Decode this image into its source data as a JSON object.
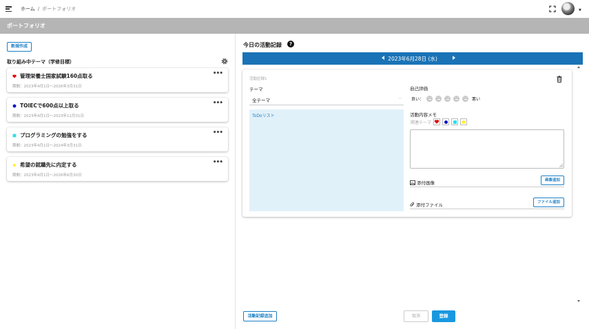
{
  "header": {
    "breadcrumb_home": "ホーム",
    "breadcrumb_sep": "/",
    "breadcrumb_current": "ポートフォリオ"
  },
  "page_title": "ポートフォリオ",
  "left": {
    "new_button": "新規作成",
    "section_title": "取り組み中テーマ（学修目標）",
    "themes": [
      {
        "title": "管理栄養士国家試験160点取る",
        "period": "期間：2023年4月1日〜2026年3月31日",
        "mark": "heart",
        "color": "#e00000"
      },
      {
        "title": "TOIECで600点以上取る",
        "period": "期間：2023年4月1日〜2023年12月31日",
        "mark": "circle",
        "color": "#0a12c8"
      },
      {
        "title": "プログラミングの勉強をする",
        "period": "期間：2023年4月1日〜2024年3月31日",
        "mark": "square",
        "color": "#2ee0e8"
      },
      {
        "title": "希望の就職先に内定する",
        "period": "期間：2023年4月1日〜2026年6月30日",
        "mark": "star",
        "color": "#ffee00"
      }
    ]
  },
  "right": {
    "title": "今日の活動記録",
    "help_icon": "?",
    "date": "2023年6月28日 (水)",
    "record": {
      "label": "活動記録1",
      "theme_label": "テーマ",
      "theme_value": "全テーマ",
      "todo_label": "ToDoリスト",
      "self_eval_label": "自己評価",
      "good": "良い",
      "bad": "悪い",
      "memo_label": "活動内容メモ",
      "related_label": "関連テーマ",
      "attach_image_label": "添付画像",
      "add_image_button": "画像追加",
      "attach_file_label": "添付ファイル",
      "add_file_button": "ファイル追加"
    }
  },
  "footer": {
    "add_record_button": "活動記録追加",
    "cancel_button": "取消",
    "submit_button": "登録"
  }
}
